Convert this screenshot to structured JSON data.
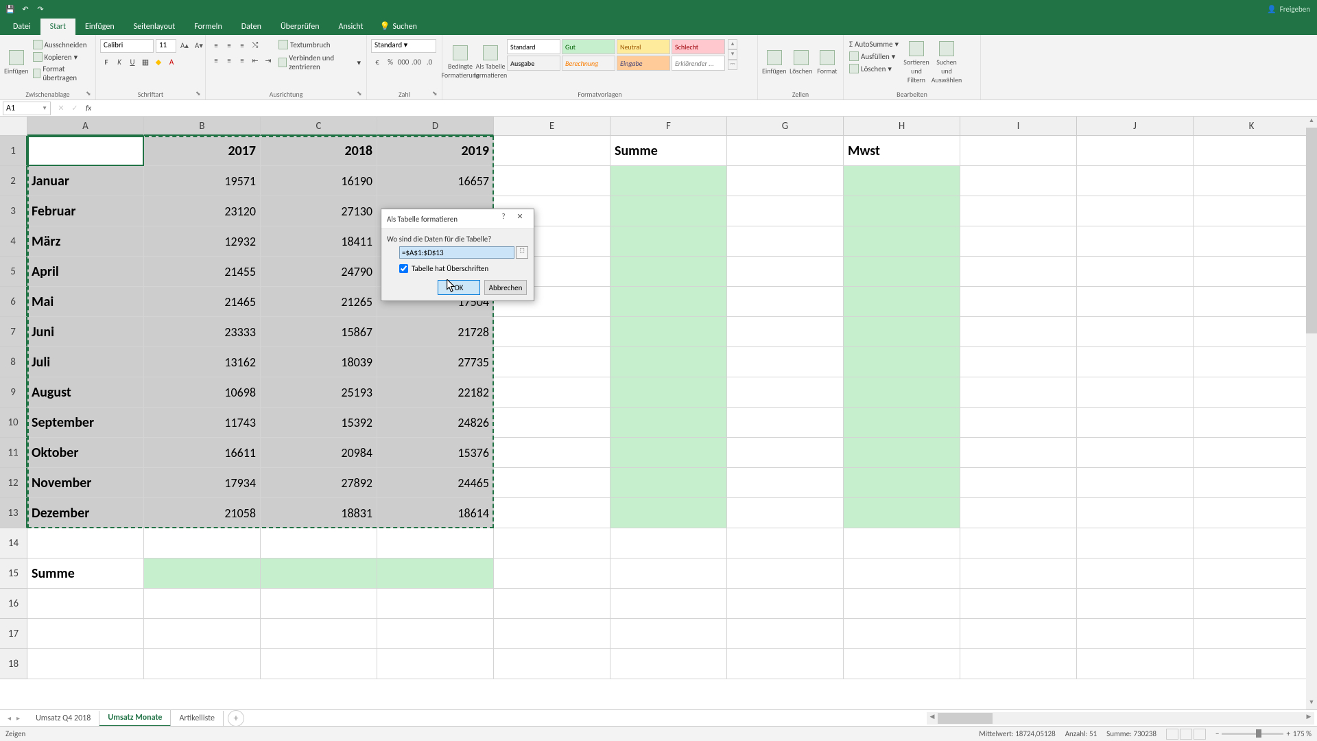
{
  "app": {
    "titlebar_right": "Freigeben"
  },
  "tabs": {
    "file": "Datei",
    "items": [
      "Start",
      "Einfügen",
      "Seitenlayout",
      "Formeln",
      "Daten",
      "Überprüfen",
      "Ansicht"
    ],
    "active": "Start",
    "search": "Suchen"
  },
  "ribbon": {
    "clipboard": {
      "label": "Zwischenablage",
      "paste": "Einfügen",
      "cut": "Ausschneiden",
      "copy": "Kopieren",
      "format_painter": "Format übertragen"
    },
    "font": {
      "label": "Schriftart",
      "name": "Calibri",
      "size": "11"
    },
    "alignment": {
      "label": "Ausrichtung",
      "wrap": "Textumbruch",
      "merge": "Verbinden und zentrieren"
    },
    "number": {
      "label": "Zahl",
      "format": "Standard"
    },
    "styles": {
      "label": "Formatvorlagen",
      "cond": "Bedingte Formatierung",
      "astable": "Als Tabelle formatieren",
      "gallery": [
        "Standard",
        "Gut",
        "Neutral",
        "Schlecht",
        "Ausgabe",
        "Berechnung",
        "Eingabe",
        "Erklärender ..."
      ]
    },
    "cells": {
      "label": "Zellen",
      "insert": "Einfügen",
      "delete": "Löschen",
      "format": "Format"
    },
    "editing": {
      "label": "Bearbeiten",
      "autosum": "AutoSumme",
      "fill": "Ausfüllen",
      "clear": "Löschen",
      "sort": "Sortieren und Filtern",
      "find": "Suchen und Auswählen"
    }
  },
  "nameBox": "A1",
  "columns": [
    "A",
    "B",
    "C",
    "D",
    "E",
    "F",
    "G",
    "H",
    "I",
    "J",
    "K"
  ],
  "rows_visible": 18,
  "colWidths": {
    "narrow": 128,
    "wide": 130
  },
  "grid": {
    "header": [
      "",
      "2017",
      "2018",
      "2019",
      "",
      "Summe",
      "",
      "Mwst",
      "",
      "",
      ""
    ],
    "rows": [
      [
        "Januar",
        "19571",
        "16190",
        "16657"
      ],
      [
        "Februar",
        "23120",
        "27130",
        ""
      ],
      [
        "März",
        "12932",
        "18411",
        ""
      ],
      [
        "April",
        "21455",
        "24790",
        ""
      ],
      [
        "Mai",
        "21465",
        "21265",
        "17504"
      ],
      [
        "Juni",
        "23333",
        "15867",
        "21728"
      ],
      [
        "Juli",
        "13162",
        "18039",
        "27735"
      ],
      [
        "August",
        "10698",
        "25193",
        "22182"
      ],
      [
        "September",
        "11743",
        "15392",
        "24826"
      ],
      [
        "Oktober",
        "16611",
        "20984",
        "15376"
      ],
      [
        "November",
        "17934",
        "27892",
        "24465"
      ],
      [
        "Dezember",
        "21058",
        "18831",
        "18614"
      ]
    ],
    "sum_label": "Summe"
  },
  "dialog": {
    "title": "Als Tabelle formatieren",
    "prompt": "Wo sind die Daten für die Tabelle?",
    "range": "=$A$1:$D$13",
    "checkbox": "Tabelle hat Überschriften",
    "ok": "OK",
    "cancel": "Abbrechen"
  },
  "sheetTabs": {
    "tabs": [
      "Umsatz Q4 2018",
      "Umsatz Monate",
      "Artikelliste"
    ],
    "active": "Umsatz Monate"
  },
  "status": {
    "mode": "Zeigen",
    "avg_label": "Mittelwert:",
    "avg": "18724,05128",
    "count_label": "Anzahl:",
    "count": "51",
    "sum_label": "Summe:",
    "sum": "730238",
    "zoom": "175 %"
  }
}
